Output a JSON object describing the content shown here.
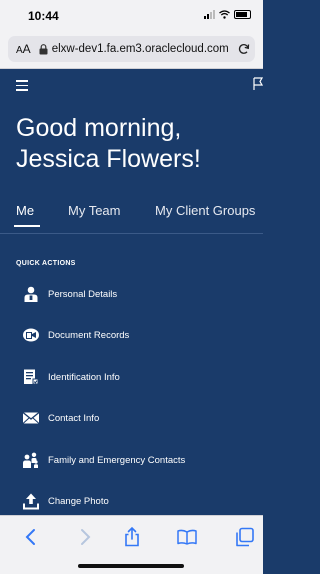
{
  "status_bar": {
    "time": "10:44"
  },
  "browser": {
    "aa_label_small": "A",
    "aa_label_large": "A",
    "url": "elxw-dev1.fa.em3.oraclecloud.com"
  },
  "greeting": "Good morning, Jessica Flowers!",
  "tabs": [
    {
      "label": "Me",
      "selected": true
    },
    {
      "label": "My Team"
    },
    {
      "label": "My Client Groups"
    }
  ],
  "quick_actions": {
    "heading": "QUICK ACTIONS",
    "items": [
      {
        "label": "Personal Details",
        "icon": "person-icon"
      },
      {
        "label": "Document Records",
        "icon": "document-records-icon"
      },
      {
        "label": "Identification Info",
        "icon": "identification-icon"
      },
      {
        "label": "Contact Info",
        "icon": "envelope-icon"
      },
      {
        "label": "Family and Emergency Contacts",
        "icon": "family-icon"
      },
      {
        "label": "Change Photo",
        "icon": "upload-icon"
      }
    ]
  },
  "colors": {
    "page_background": "#1a3b6a",
    "browser_chrome": "#f2f2f4",
    "toolbar_accent": "#3478f6",
    "text": "#ffffff"
  },
  "bottom_toolbar": {
    "buttons": [
      "back-icon",
      "forward-icon",
      "share-icon",
      "bookmarks-icon",
      "tabs-icon"
    ]
  }
}
